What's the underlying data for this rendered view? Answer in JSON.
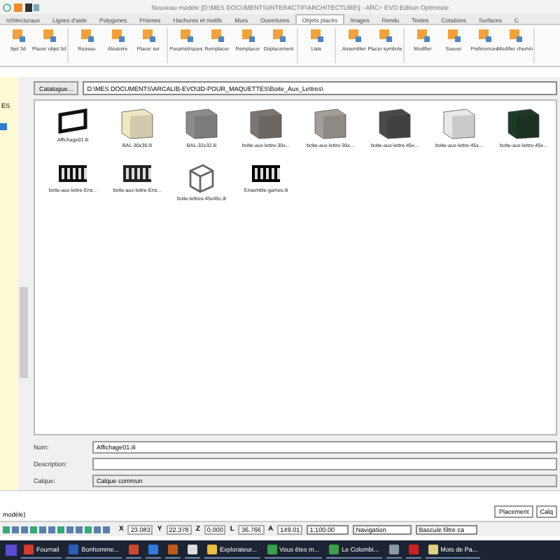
{
  "window": {
    "title": "Nouveau modèle [D:\\MES DOCUMENTS\\INTERACTIF\\ARCHITECTURE\\] - ARC+ EVO Edition Optimisée"
  },
  "tabs": [
    {
      "label": "rchitecturaux",
      "selected": false
    },
    {
      "label": "Lignes d'aide",
      "selected": false
    },
    {
      "label": "Polygones",
      "selected": false
    },
    {
      "label": "Prismes",
      "selected": false
    },
    {
      "label": "Hachures et motifs",
      "selected": false
    },
    {
      "label": "Murs",
      "selected": false
    },
    {
      "label": "Ouvertures",
      "selected": false
    },
    {
      "label": "Objets placés",
      "selected": true
    },
    {
      "label": "Images",
      "selected": false
    },
    {
      "label": "Rendu",
      "selected": false
    },
    {
      "label": "Textes",
      "selected": false
    },
    {
      "label": "Cotations",
      "selected": false
    },
    {
      "label": "Surfaces",
      "selected": false
    },
    {
      "label": "C",
      "selected": false
    }
  ],
  "ribbon": {
    "groups": [
      [
        "bjet 3d",
        "Placer objet 3d"
      ],
      [
        "Réseau",
        "Aléatoire",
        "Placer sur"
      ],
      [
        "Paramétriques",
        "Remplacer",
        "Remplacer",
        "Déplacement"
      ],
      [
        "Liste"
      ],
      [
        "Assembler",
        "Placer symbole"
      ],
      [
        "Modifier",
        "Sauver",
        "Préférences",
        "Modifier chemin"
      ]
    ]
  },
  "sidebar": {
    "items": [
      {
        "label": "ES",
        "selected": false
      },
      {
        "selected": true
      }
    ]
  },
  "catalogue": {
    "button": "Catalogue...",
    "path": "D:\\MES DOCUMENTS\\ARCALIB-EVO\\3D-POUR_MAQUETTES\\Boite_Aux_Lettres\\"
  },
  "files": [
    {
      "name": "Affichage01.ili",
      "kind": "frame",
      "color": "#111111"
    },
    {
      "name": "BAL-30x30.ili",
      "kind": "cube",
      "color": "#efe6c2"
    },
    {
      "name": "BAL-32x32.ili",
      "kind": "cube",
      "color": "#8c8c8c"
    },
    {
      "name": "boite-aux-lettre-30x...",
      "kind": "cube",
      "color": "#7a7570"
    },
    {
      "name": "boite-aux-lettre-30x...",
      "kind": "cube",
      "color": "#a39e98"
    },
    {
      "name": "boite-aux-lettre-45x...",
      "kind": "cube",
      "color": "#4a4a4a"
    },
    {
      "name": "boite-aux-lettre-45x...",
      "kind": "cube",
      "color": "#e8e8e8"
    },
    {
      "name": "boite-aux-lettre-45x...",
      "kind": "cube",
      "color": "#1d3a26"
    },
    {
      "name": "boite-aux-lettre-Ens...",
      "kind": "grid",
      "color": "#111111"
    },
    {
      "name": "boite-aux-lettre-Ens...",
      "kind": "grid",
      "color": "#222222"
    },
    {
      "name": "boite-lettres-45x45c.ili",
      "kind": "wire",
      "color": "#666666"
    },
    {
      "name": "Ensemble-games.ili",
      "kind": "grid",
      "color": "#000000"
    }
  ],
  "form": [
    {
      "label": "Nom:",
      "value": "Affichage01.ili",
      "disabled": false
    },
    {
      "label": "Description:",
      "disabled": false
    },
    {
      "label": "Calque:",
      "value": "Calque commun",
      "disabled": true
    }
  ],
  "status": {
    "left": "modèle)",
    "placement": "Placement",
    "layer": "Calq"
  },
  "coords": [
    {
      "axis": "X",
      "value": "23.083"
    },
    {
      "axis": "Y",
      "value": "22.378"
    },
    {
      "axis": "Z",
      "value": "0.000"
    },
    {
      "axis": "L",
      "value": "36.766"
    },
    {
      "axis": "A",
      "value": "149.01"
    }
  ],
  "scale": "1:100.00",
  "mode": "Navigation",
  "filter": "Bascule filtre ca",
  "taskbar": [
    {
      "label": "Fournail",
      "color": "#d83b2b"
    },
    {
      "label": "Bonhomme...",
      "color": "#2b5bb8"
    },
    {
      "color": "#d04a2a"
    },
    {
      "color": "#2f7be0"
    },
    {
      "color": "#c05a1a"
    },
    {
      "color": "#dddddd"
    },
    {
      "label": "Explorateur...",
      "color": "#e8c040"
    },
    {
      "label": "Vous êtes m...",
      "color": "#3aa04a"
    },
    {
      "label": "Le Colombi...",
      "color": "#3aa04a"
    },
    {
      "color": "#8899aa"
    },
    {
      "color": "#d02020"
    },
    {
      "label": "Mots de Pa...",
      "color": "#e0d080"
    }
  ]
}
